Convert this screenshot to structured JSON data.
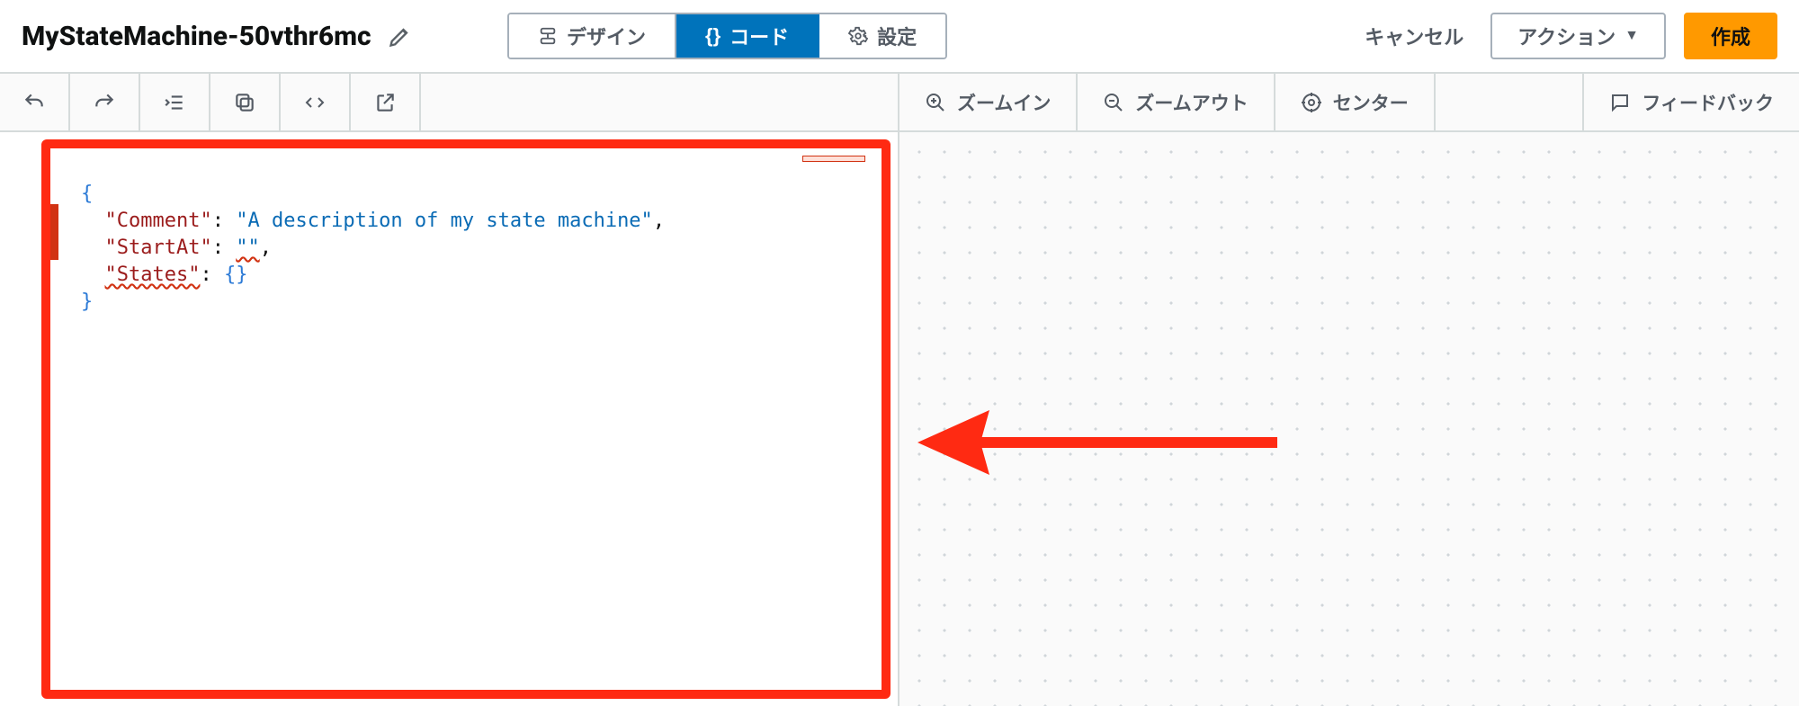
{
  "header": {
    "title": "MyStateMachine-50vthr6mc",
    "tabs": {
      "design": "デザイン",
      "code": "コード",
      "settings": "設定"
    },
    "cancel": "キャンセル",
    "actions": "アクション",
    "create": "作成"
  },
  "canvas_toolbar": {
    "zoom_in": "ズームイン",
    "zoom_out": "ズームアウト",
    "center": "センター",
    "feedback": "フィードバック"
  },
  "code": {
    "line1": "{",
    "line2_key": "\"Comment\"",
    "line2_sep": ": ",
    "line2_val": "\"A description of my state machine\"",
    "line2_end": ",",
    "line3_key": "\"StartAt\"",
    "line3_sep": ": ",
    "line3_val": "\"\"",
    "line3_end": ",",
    "line4_key": "\"States\"",
    "line4_sep": ": ",
    "line4_val": "{}",
    "line5": "}"
  }
}
